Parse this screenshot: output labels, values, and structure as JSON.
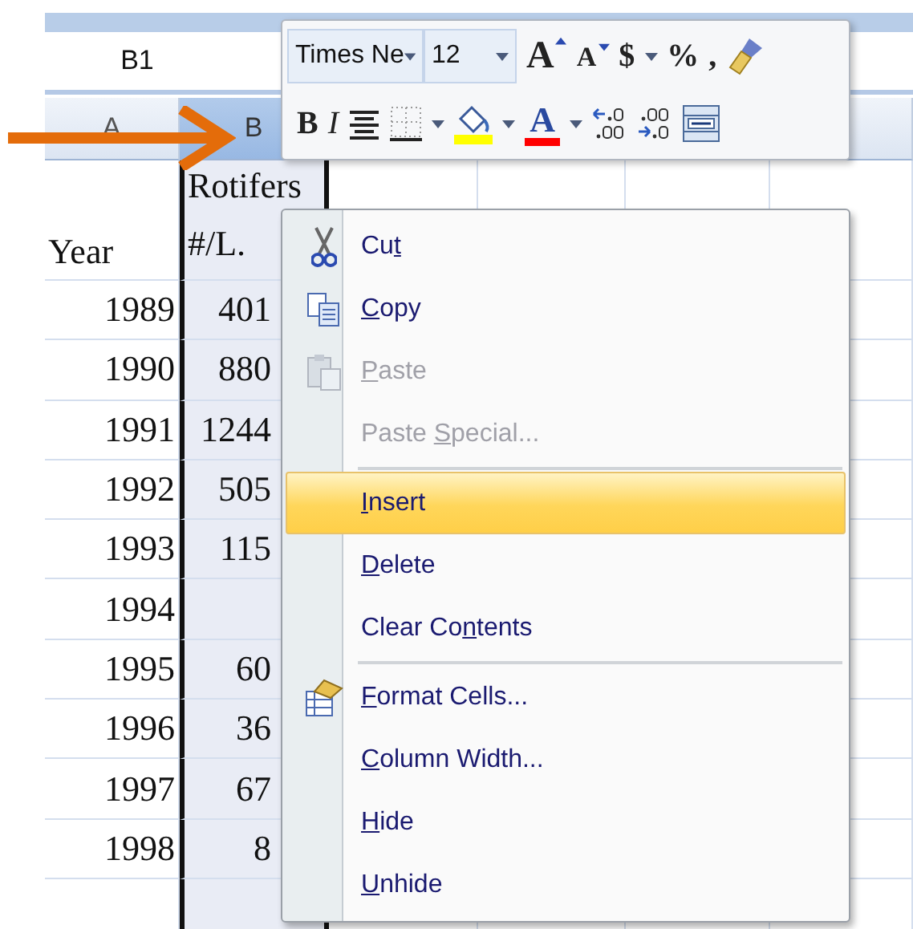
{
  "name_box": "B1",
  "columns": [
    {
      "label": "A",
      "selected": false
    },
    {
      "label": "B",
      "selected": true
    }
  ],
  "header_row": {
    "col_a": "Year",
    "col_b": "Rotifers #/L."
  },
  "rows": [
    {
      "year": "1989",
      "value": "401"
    },
    {
      "year": "1990",
      "value": "880"
    },
    {
      "year": "1991",
      "value": "1244"
    },
    {
      "year": "1992",
      "value": "505"
    },
    {
      "year": "1993",
      "value": "115"
    },
    {
      "year": "1994"
    },
    {
      "year": "1995",
      "value": "60"
    },
    {
      "year": "1996",
      "value": "36"
    },
    {
      "year": "1997",
      "value": "67"
    },
    {
      "year": "1998",
      "value": "8"
    }
  ],
  "mini_toolbar": {
    "row_1": [
      {
        "kind": "font-field",
        "value": "Times Ne"
      },
      {
        "kind": "size-field",
        "value": "12"
      },
      {
        "kind": "grow-font",
        "glyph": "A"
      },
      {
        "kind": "shrink-font",
        "glyph": "A"
      },
      {
        "kind": "glyph",
        "glyph": "$"
      },
      {
        "kind": "dropdown"
      },
      {
        "kind": "glyph",
        "glyph": "%"
      },
      {
        "kind": "glyph",
        "glyph": ","
      },
      {
        "kind": "format-painter"
      }
    ],
    "row_2": [
      {
        "kind": "bold",
        "glyph": "B"
      },
      {
        "kind": "italic",
        "glyph": "I"
      },
      {
        "kind": "center"
      },
      {
        "kind": "borders"
      },
      {
        "kind": "dropdown"
      },
      {
        "kind": "fill-color"
      },
      {
        "kind": "dropdown"
      },
      {
        "kind": "font-color",
        "glyph": "A"
      },
      {
        "kind": "dropdown"
      },
      {
        "kind": "increase-decimal"
      },
      {
        "kind": "decrease-decimal"
      },
      {
        "kind": "merge"
      }
    ]
  },
  "context_menu": [
    {
      "kind": "item",
      "before": "Cu",
      "key": "t",
      "disabled": false,
      "selected": false
    },
    {
      "kind": "item",
      "key": "C",
      "after": "opy",
      "disabled": false,
      "selected": false
    },
    {
      "kind": "item",
      "key": "P",
      "after": "aste",
      "disabled": true,
      "selected": false
    },
    {
      "kind": "item",
      "before": "Paste ",
      "key": "S",
      "after": "pecial...",
      "disabled": true,
      "selected": false
    },
    {
      "kind": "separator"
    },
    {
      "kind": "item",
      "key": "I",
      "after": "nsert",
      "disabled": false,
      "selected": true
    },
    {
      "kind": "item",
      "key": "D",
      "after": "elete",
      "disabled": false,
      "selected": false
    },
    {
      "kind": "item",
      "before": "Clear Co",
      "key": "n",
      "after": "tents",
      "disabled": false,
      "selected": false
    },
    {
      "kind": "separator"
    },
    {
      "kind": "item",
      "key": "F",
      "after": "ormat Cells...",
      "disabled": false,
      "selected": false
    },
    {
      "kind": "item",
      "key": "C",
      "after": "olumn Width...",
      "disabled": false,
      "selected": false
    },
    {
      "kind": "item",
      "key": "H",
      "after": "ide",
      "disabled": false,
      "selected": false
    },
    {
      "kind": "item",
      "key": "U",
      "after": "nhide",
      "disabled": false,
      "selected": false
    }
  ]
}
